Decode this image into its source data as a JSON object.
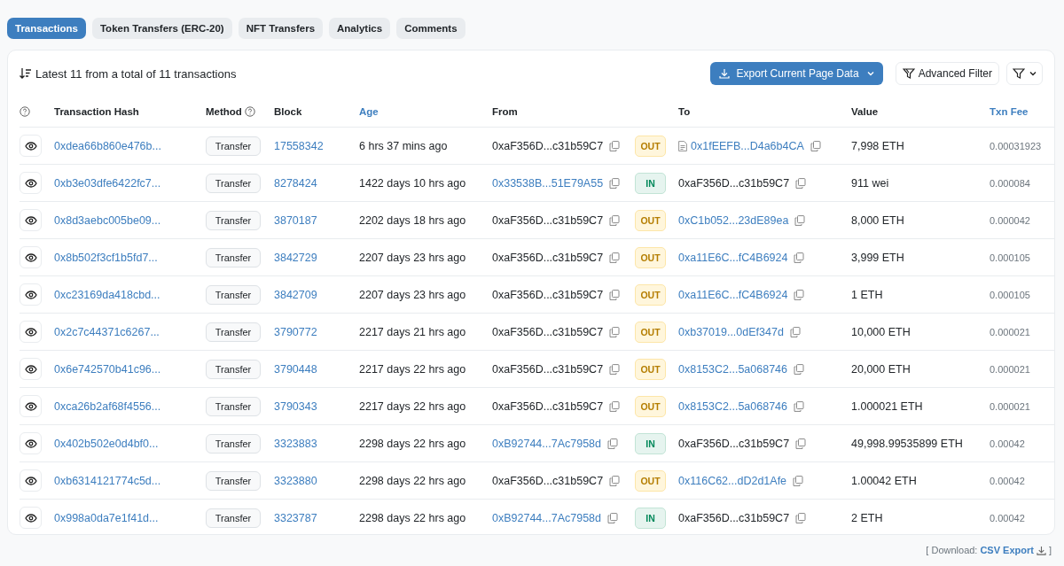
{
  "tabs": [
    {
      "label": "Transactions",
      "selected": true
    },
    {
      "label": "Token Transfers (ERC-20)",
      "selected": false
    },
    {
      "label": "NFT Transfers",
      "selected": false
    },
    {
      "label": "Analytics",
      "selected": false
    },
    {
      "label": "Comments",
      "selected": false
    }
  ],
  "summary": "Latest 11 from a total of 11 transactions",
  "toolbar": {
    "export_button": "Export Current Page Data",
    "filter_button": "Advanced Filter"
  },
  "table": {
    "columns": [
      {
        "label": "Transaction Hash",
        "highlighted": false,
        "help": false
      },
      {
        "label": "Method",
        "highlighted": false,
        "help": true
      },
      {
        "label": "Block",
        "highlighted": false,
        "help": false
      },
      {
        "label": "Age",
        "highlighted": true,
        "help": false
      },
      {
        "label": "From",
        "highlighted": false,
        "help": false
      },
      {
        "label": "To",
        "highlighted": false,
        "help": false
      },
      {
        "label": "Value",
        "highlighted": false,
        "help": false
      },
      {
        "label": "Txn Fee",
        "highlighted": true,
        "help": false
      }
    ],
    "rows": [
      {
        "hash": "0xdea66b860e476b...",
        "method": "Transfer",
        "block": "17558342",
        "age": "6 hrs 37 mins ago",
        "from": {
          "text": "0xaF356D...c31b59C7",
          "linked": false
        },
        "direction": {
          "label": "OUT",
          "kind": "out"
        },
        "to": {
          "text": "0x1fEEFB...D4a6b4CA",
          "linked": true,
          "contract": true
        },
        "value": "7,998 ETH",
        "fee": "0.00031923"
      },
      {
        "hash": "0xb3e03dfe6422fc7...",
        "method": "Transfer",
        "block": "8278424",
        "age": "1422 days 10 hrs ago",
        "from": {
          "text": "0x33538B...51E79A55",
          "linked": true
        },
        "direction": {
          "label": "IN",
          "kind": "in"
        },
        "to": {
          "text": "0xaF356D...c31b59C7",
          "linked": false,
          "contract": false
        },
        "value": "911 wei",
        "fee": "0.000084"
      },
      {
        "hash": "0x8d3aebc005be09...",
        "method": "Transfer",
        "block": "3870187",
        "age": "2202 days 18 hrs ago",
        "from": {
          "text": "0xaF356D...c31b59C7",
          "linked": false
        },
        "direction": {
          "label": "OUT",
          "kind": "out"
        },
        "to": {
          "text": "0xC1b052...23dE89ea",
          "linked": true,
          "contract": false
        },
        "value": "8,000 ETH",
        "fee": "0.000042"
      },
      {
        "hash": "0x8b502f3cf1b5fd7...",
        "method": "Transfer",
        "block": "3842729",
        "age": "2207 days 23 hrs ago",
        "from": {
          "text": "0xaF356D...c31b59C7",
          "linked": false
        },
        "direction": {
          "label": "OUT",
          "kind": "out"
        },
        "to": {
          "text": "0xa11E6C...fC4B6924",
          "linked": true,
          "contract": false
        },
        "value": "3,999 ETH",
        "fee": "0.000105"
      },
      {
        "hash": "0xc23169da418cbd...",
        "method": "Transfer",
        "block": "3842709",
        "age": "2207 days 23 hrs ago",
        "from": {
          "text": "0xaF356D...c31b59C7",
          "linked": false
        },
        "direction": {
          "label": "OUT",
          "kind": "out"
        },
        "to": {
          "text": "0xa11E6C...fC4B6924",
          "linked": true,
          "contract": false
        },
        "value": "1 ETH",
        "fee": "0.000105"
      },
      {
        "hash": "0x2c7c44371c6267...",
        "method": "Transfer",
        "block": "3790772",
        "age": "2217 days 21 hrs ago",
        "from": {
          "text": "0xaF356D...c31b59C7",
          "linked": false
        },
        "direction": {
          "label": "OUT",
          "kind": "out"
        },
        "to": {
          "text": "0xb37019...0dEf347d",
          "linked": true,
          "contract": false
        },
        "value": "10,000 ETH",
        "fee": "0.000021"
      },
      {
        "hash": "0x6e742570b41c96...",
        "method": "Transfer",
        "block": "3790448",
        "age": "2217 days 22 hrs ago",
        "from": {
          "text": "0xaF356D...c31b59C7",
          "linked": false
        },
        "direction": {
          "label": "OUT",
          "kind": "out"
        },
        "to": {
          "text": "0x8153C2...5a068746",
          "linked": true,
          "contract": false
        },
        "value": "20,000 ETH",
        "fee": "0.000021"
      },
      {
        "hash": "0xca26b2af68f4556...",
        "method": "Transfer",
        "block": "3790343",
        "age": "2217 days 22 hrs ago",
        "from": {
          "text": "0xaF356D...c31b59C7",
          "linked": false
        },
        "direction": {
          "label": "OUT",
          "kind": "out"
        },
        "to": {
          "text": "0x8153C2...5a068746",
          "linked": true,
          "contract": false
        },
        "value": "1.000021 ETH",
        "fee": "0.000021"
      },
      {
        "hash": "0x402b502e0d4bf0...",
        "method": "Transfer",
        "block": "3323883",
        "age": "2298 days 22 hrs ago",
        "from": {
          "text": "0xB92744...7Ac7958d",
          "linked": true
        },
        "direction": {
          "label": "IN",
          "kind": "in"
        },
        "to": {
          "text": "0xaF356D...c31b59C7",
          "linked": false,
          "contract": false
        },
        "value": "49,998.99535899 ETH",
        "fee": "0.00042"
      },
      {
        "hash": "0xb6314121774c5d...",
        "method": "Transfer",
        "block": "3323880",
        "age": "2298 days 22 hrs ago",
        "from": {
          "text": "0xaF356D...c31b59C7",
          "linked": false
        },
        "direction": {
          "label": "OUT",
          "kind": "out"
        },
        "to": {
          "text": "0x116C62...dD2d1Afe",
          "linked": true,
          "contract": false
        },
        "value": "1.00042 ETH",
        "fee": "0.00042"
      },
      {
        "hash": "0x998a0da7e1f41d...",
        "method": "Transfer",
        "block": "3323787",
        "age": "2298 days 22 hrs ago",
        "from": {
          "text": "0xB92744...7Ac7958d",
          "linked": true
        },
        "direction": {
          "label": "IN",
          "kind": "in"
        },
        "to": {
          "text": "0xaF356D...c31b59C7",
          "linked": false,
          "contract": false
        },
        "value": "2 ETH",
        "fee": "0.00042"
      }
    ]
  },
  "footer": {
    "prefix": "[ Download:",
    "link": "CSV Export",
    "suffix": "]"
  }
}
